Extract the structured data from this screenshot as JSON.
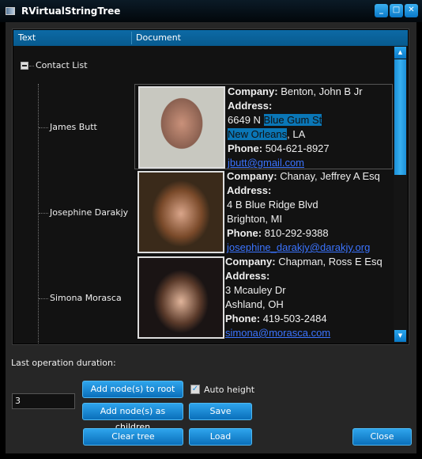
{
  "window": {
    "title": "RVirtualStringTree",
    "minimize": "_",
    "maximize": "□",
    "close": "✕"
  },
  "tree": {
    "columns": [
      "Text",
      "Document"
    ],
    "root": "Contact List",
    "contacts": [
      {
        "name": "James Butt",
        "company": "Benton, John B Jr",
        "address1_plain": "6649 N ",
        "address1_sel": "Blue Gum St",
        "address2_sel": "New Orleans",
        "address2_plain": ", LA",
        "phone": "504-621-8927",
        "email": "jbutt@gmail.com"
      },
      {
        "name": "Josephine Darakjy",
        "company": "Chanay, Jeffrey A Esq",
        "address1": "4 B Blue Ridge Blvd",
        "address2": "Brighton, MI",
        "phone": "810-292-9388",
        "email": "josephine_darakjy@darakjy.org"
      },
      {
        "name": "Simona Morasca",
        "company": "Chapman, Ross E Esq",
        "address1": "3 Mcauley Dr",
        "address2": "Ashland, OH",
        "phone": "419-503-2484",
        "email": "simona@morasca.com"
      }
    ],
    "labels": {
      "company": "Company:",
      "address": "Address:",
      "phone": "Phone:"
    }
  },
  "controls": {
    "duration_label": "Last operation duration:",
    "count_value": "3",
    "add_root": "Add node(s) to root",
    "add_children": "Add node(s) as children",
    "auto_height": "Auto height",
    "auto_height_checked": true,
    "save": "Save",
    "clear": "Clear tree",
    "load": "Load",
    "close": "Close"
  }
}
